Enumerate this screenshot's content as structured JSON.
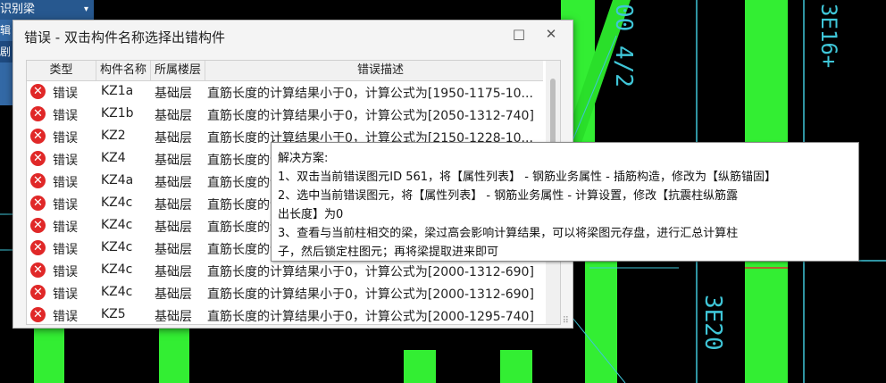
{
  "topbar": {
    "label": "识别梁",
    "arrow": "▾"
  },
  "sidebar": {
    "items": [
      "辑",
      "剧"
    ]
  },
  "background": {
    "labels": [
      "00 4/2",
      "3E16+",
      "3E20"
    ]
  },
  "dialog": {
    "title": "错误 - 双击构件名称选择出错构件",
    "maximize_icon": "□",
    "close_icon": "✕",
    "columns": [
      "类型",
      "构件名称",
      "所属楼层",
      "错误描述"
    ],
    "rows": [
      {
        "type": "错误",
        "name": "KZ1a",
        "floor": "基础层",
        "desc": "直筋长度的计算结果小于0，计算公式为[1950-1175-10..."
      },
      {
        "type": "错误",
        "name": "KZ1b",
        "floor": "基础层",
        "desc": "直筋长度的计算结果小于0，计算公式为[2050-1312-740]"
      },
      {
        "type": "错误",
        "name": "KZ2",
        "floor": "基础层",
        "desc": "直筋长度的计算结果小于0，计算公式为[2150-1228-10..."
      },
      {
        "type": "错误",
        "name": "KZ4",
        "floor": "基础层",
        "desc": "直筋长度的计"
      },
      {
        "type": "错误",
        "name": "KZ4a",
        "floor": "基础层",
        "desc": "直筋长度的计"
      },
      {
        "type": "错误",
        "name": "KZ4c",
        "floor": "基础层",
        "desc": "直筋长度的计"
      },
      {
        "type": "错误",
        "name": "KZ4c",
        "floor": "基础层",
        "desc": "直筋长度的计"
      },
      {
        "type": "错误",
        "name": "KZ4c",
        "floor": "基础层",
        "desc": "直筋长度的计"
      },
      {
        "type": "错误",
        "name": "KZ4c",
        "floor": "基础层",
        "desc": "直筋长度的计算结果小于0，计算公式为[2000-1312-690]"
      },
      {
        "type": "错误",
        "name": "KZ4c",
        "floor": "基础层",
        "desc": "直筋长度的计算结果小于0，计算公式为[2000-1312-690]"
      },
      {
        "type": "错误",
        "name": "KZ5",
        "floor": "基础层",
        "desc": "直筋长度的计算结果小于0，计算公式为[2000-1295-740]"
      }
    ]
  },
  "tooltip": {
    "lines": [
      "解决方案:",
      "1、双击当前错误图元ID 561，将【属性列表】 - 钢筋业务属性 - 插筋构造，修改为【纵筋锚固】",
      "2、选中当前错误图元，将【属性列表】 - 钢筋业务属性 - 计算设置，修改【抗震柱纵筋露",
      "出长度】为0",
      "3、查看与当前柱相交的梁，梁过高会影响计算结果，可以将梁图元存盘，进行汇总计算柱",
      "子，然后锁定柱图元；再将梁提取进来即可"
    ]
  },
  "colors": {
    "accent_green": "#2ee82e",
    "cad_cyan": "#3fc6d8",
    "error_red": "#e02828"
  }
}
